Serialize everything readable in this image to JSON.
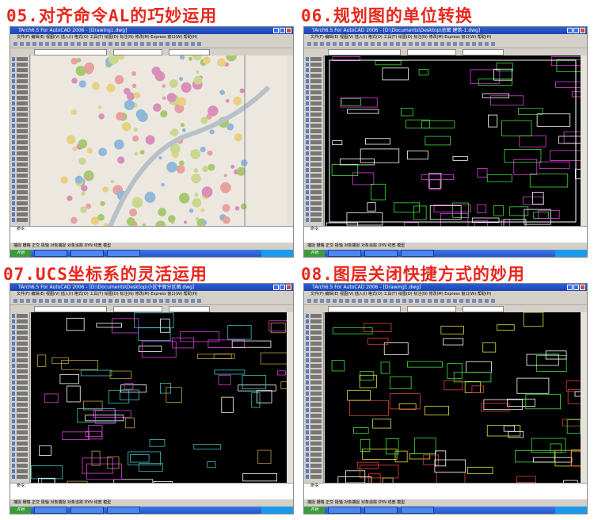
{
  "panels": [
    {
      "title": "05.对齐命令AL的巧妙运用",
      "window_title": "TArch6.5 For AutoCAD 2006 - [Drawing1.dwg]",
      "theme": "light"
    },
    {
      "title": "06.规划图的单位转换",
      "window_title": "TArch6.5 For AutoCAD 2006 - [D:\\Documents\\Desktop\\总图 建筑-1.dwg]",
      "theme": "dark"
    },
    {
      "title": "07.UCS坐标系的灵活运用",
      "window_title": "TArch6.5 For AutoCAD 2006 - [D:\\Documents\\Desktop\\小区平面分区图.dwg]",
      "theme": "dark"
    },
    {
      "title": "08.图层关闭快捷方式的妙用",
      "window_title": "TArch6.5 For AutoCAD 2006 - [Drawing1.dwg]",
      "theme": "dark"
    }
  ],
  "menu": "文件(F) 编辑(E) 视图(V) 插入(I) 格式(O) 工具(T) 绘图(D) 标注(N) 修改(M) Express 窗口(W) 帮助(H)",
  "command_prompt": "命令:",
  "status_text": "捕捉 栅格 正交 极轴 对象捕捉 对象追踪 DYN 线宽 模型",
  "start_label": "开始",
  "colors": {
    "title_red": "#e8261c",
    "titlebar_blue": "#2a5fd8",
    "cad_bg": "#000000"
  }
}
